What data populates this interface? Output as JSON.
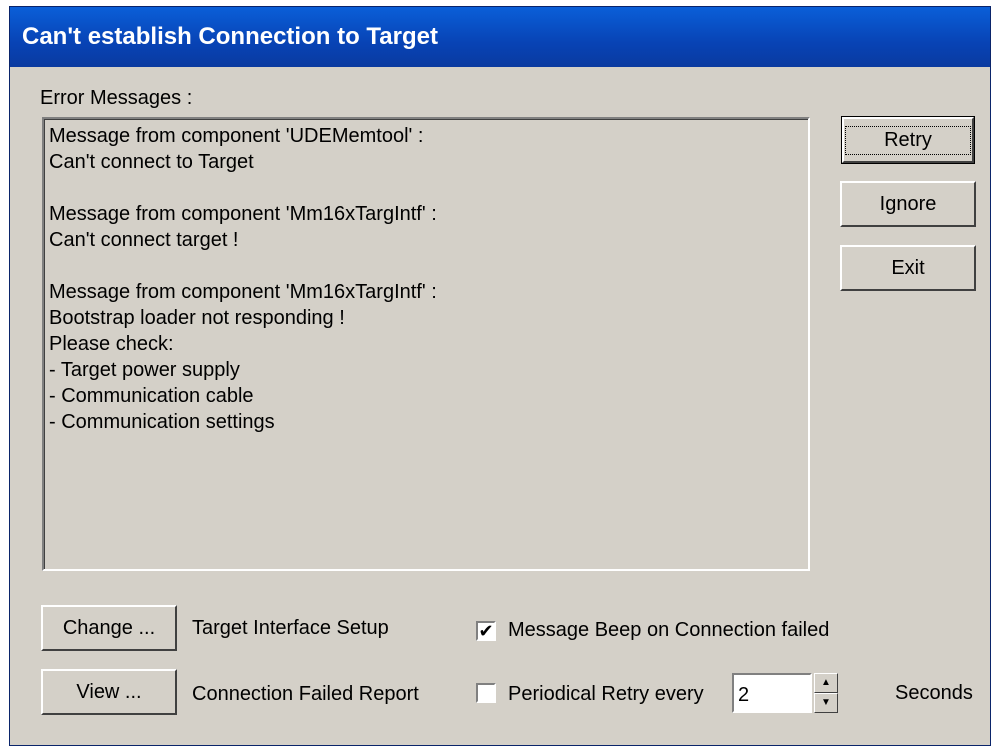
{
  "window": {
    "title": "Can't establish Connection to Target"
  },
  "error_messages_label": "Error Messages :",
  "messages": [
    "Message from component 'UDEMemtool' :",
    "Can't connect to Target",
    "",
    "Message from component 'Mm16xTargIntf' :",
    "Can't connect target !",
    "",
    "Message from component 'Mm16xTargIntf' :",
    "Bootstrap loader not responding !",
    "Please check:",
    "- Target power supply",
    "- Communication cable",
    "- Communication settings"
  ],
  "buttons": {
    "retry": "Retry",
    "ignore": "Ignore",
    "exit": "Exit",
    "change": "Change ...",
    "view": "View ..."
  },
  "labels": {
    "target_interface_setup": "Target Interface Setup",
    "connection_failed_report": "Connection Failed Report",
    "message_beep": "Message Beep on Connection failed",
    "periodical_retry": "Periodical Retry every",
    "seconds": "Seconds"
  },
  "checkboxes": {
    "message_beep_checked": true,
    "periodical_retry_checked": false
  },
  "retry_interval": {
    "value": "2"
  },
  "icons": {
    "checkmark": "checkmark-icon",
    "spin_up": "arrow-up-icon",
    "spin_down": "arrow-down-icon"
  }
}
